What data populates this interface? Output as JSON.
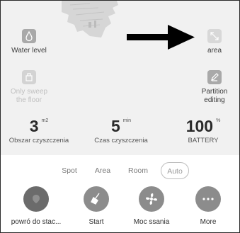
{
  "tiles": {
    "water_level": "Water level",
    "area": "area",
    "only_sweep": "Only sweep",
    "only_sweep_line2": "the floor",
    "partition": "Partition",
    "partition_line2": "editing"
  },
  "stats": [
    {
      "value": "3",
      "unit": "m2",
      "caption": "Obszar czyszczenia"
    },
    {
      "value": "5",
      "unit": "min",
      "caption": "Czas czyszczenia"
    },
    {
      "value": "100",
      "unit": "%",
      "caption": "BATTERY"
    }
  ],
  "modes": [
    "Spot",
    "Area",
    "Room",
    "Auto"
  ],
  "selected_mode": "Auto",
  "actions": [
    "powró do stac...",
    "Start",
    "Moc ssania",
    "More"
  ],
  "icons": {
    "water_level": "water-drop-icon",
    "area": "expand-area-icon",
    "only_sweep": "sweep-floor-icon",
    "partition": "edit-pencil-icon",
    "dock": "home-dock-icon",
    "start": "broom-icon",
    "suction": "fan-icon",
    "more": "more-dots-icon"
  }
}
